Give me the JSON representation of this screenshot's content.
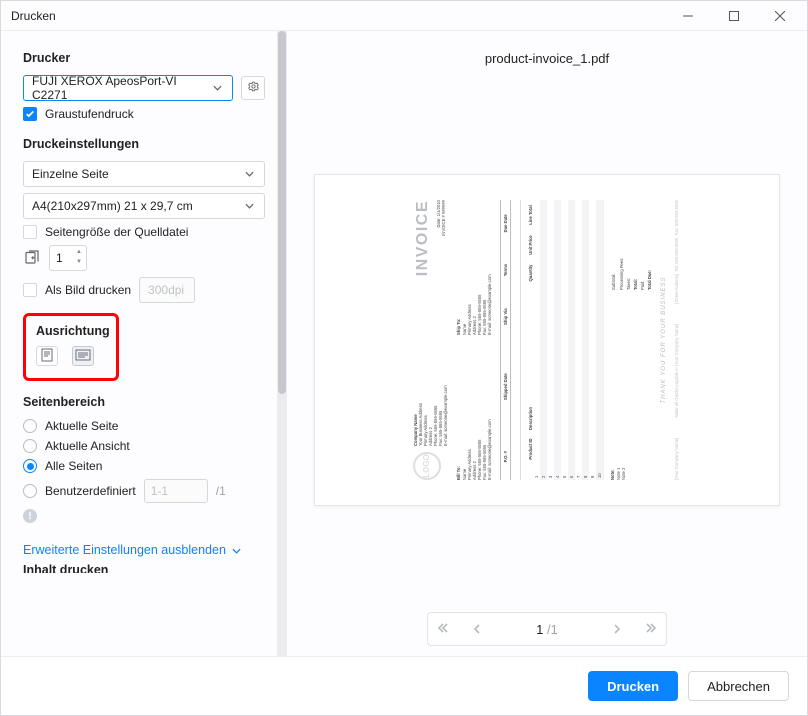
{
  "window": {
    "title": "Drucken"
  },
  "sidebar": {
    "printer_section": "Drucker",
    "printer_selected": "FUJI XEROX ApeosPort-VI C2271",
    "grayscale_label": "Graustufendruck",
    "grayscale_checked": true,
    "settings_section": "Druckeinstellungen",
    "pages_per_sheet": "Einzelne Seite",
    "paper_size": "A4(210x297mm) 21 x 29,7 cm",
    "use_source_size_label": "Seitengröße der Quelldatei",
    "copies_value": "1",
    "print_as_image_label": "Als Bild drucken",
    "dpi_placeholder": "300dpi",
    "orientation_section": "Ausrichtung",
    "page_range_section": "Seitenbereich",
    "range": {
      "current_page": "Aktuelle Seite",
      "current_view": "Aktuelle Ansicht",
      "all_pages": "Alle Seiten",
      "custom": "Benutzerdefiniert",
      "custom_placeholder": "1-1",
      "total_suffix": "/1"
    },
    "advanced_link": "Erweiterte Einstellungen ausblenden",
    "clipped_section": "Inhalt drucken"
  },
  "preview": {
    "filename": "product-invoice_1.pdf",
    "pager": {
      "current": "1",
      "sep": " /",
      "total": "1"
    }
  },
  "invoice": {
    "logo_text": "LOGO",
    "company_name": "Company Name",
    "company_sub": "Your Business Address",
    "company_Addr1": "Primary Address",
    "company_Addr2": "Address 2",
    "company_phone": "Phone: 555-555-5555",
    "company_fax": "Fax: 555-555-5555",
    "company_email": "E-mail: someone@example.com",
    "title": "INVOICE",
    "date_label": "Date: 1/1/2010",
    "inv_no_label": "INVOICE # ######",
    "billto": "Bill To:",
    "shipto": "Ship To:",
    "addr_name": "Name",
    "addr1": "Primary Address",
    "addr2": "Address 2",
    "addr_phone": "Phone: 555-555-5555",
    "addr_fax": "Fax: 555-555-5555",
    "addr_email": "E-mail: someone@example.com",
    "bar": {
      "po": "P.O. #",
      "shipped": "Shipped Date",
      "via": "Ship Via",
      "terms": "Terms",
      "due": "Due Date"
    },
    "cols": {
      "id": "Product ID",
      "desc": "Description",
      "qty": "Quantity",
      "unit": "Unit Price",
      "line": "Line Total"
    },
    "row_ids": [
      "1",
      "2",
      "3",
      "4",
      "5",
      "6",
      "7",
      "8",
      "9",
      "10"
    ],
    "notes_label": "Note:",
    "note1": "Note 1",
    "note2": "Note 2",
    "totals": {
      "subtotal": "Subtotal:",
      "proc": "Processing Fees:",
      "tax": "Taxes:",
      "total": "Total:",
      "paid": "Paid:",
      "due": "Total Due:"
    },
    "thanks": "THANK YOU FOR YOUR BUSINESS",
    "foot_left": "[Your Company Name]",
    "foot_center": "Make all checks payable to [Your Company Name]",
    "foot_right1": "[Street Address]",
    "foot_right2": "Tel: 555-555-5555",
    "foot_right3": "Fax: 555-555-5555"
  },
  "footer": {
    "print": "Drucken",
    "cancel": "Abbrechen"
  }
}
